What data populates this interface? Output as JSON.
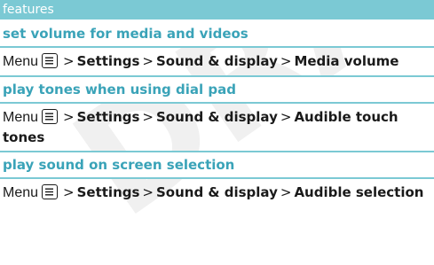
{
  "watermark": "DRAFT",
  "header": {
    "label": "features"
  },
  "sections": [
    {
      "title": "set volume for media and videos",
      "menu_word": "Menu",
      "sep1": ">",
      "step1": "Settings",
      "sep2": ">",
      "step2": "Sound & display",
      "sep3": ">",
      "step3": "Media volume"
    },
    {
      "title": "play tones when using dial pad",
      "menu_word": "Menu",
      "sep1": ">",
      "step1": "Settings",
      "sep2": ">",
      "step2": "Sound & display",
      "sep3": ">",
      "step3": "Audible touch tones"
    },
    {
      "title": "play sound on screen selection",
      "menu_word": "Menu",
      "sep1": ">",
      "step1": "Settings",
      "sep2": ">",
      "step2": "Sound & display",
      "sep3": ">",
      "step3": "Audible selection"
    }
  ],
  "icons": {
    "menu_key": "menu-key-icon"
  },
  "colors": {
    "accent": "#7bc9d4",
    "title": "#3aa3b8",
    "text": "#1a1a1a",
    "watermark": "#f2f2f2"
  }
}
